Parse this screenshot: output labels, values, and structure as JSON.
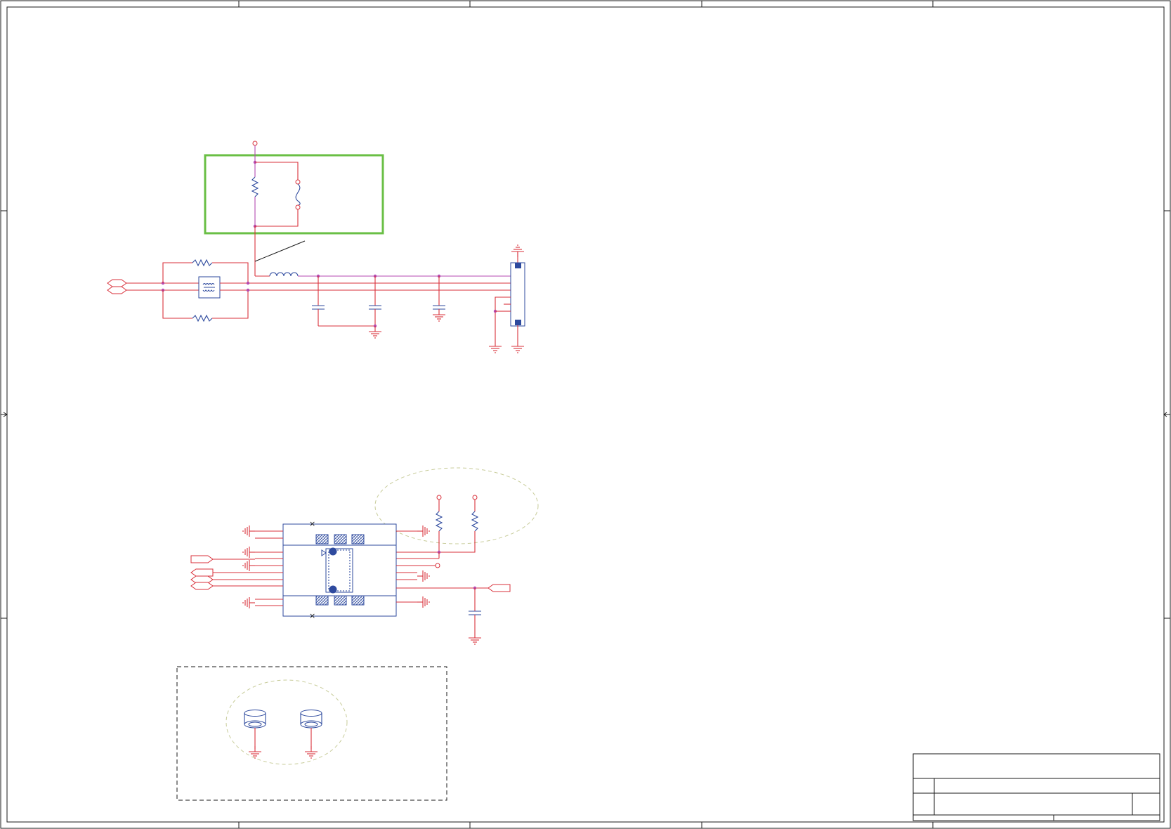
{
  "sheet": {
    "border_color": "#1a1a1a",
    "zone_columns": 5,
    "zone_rows": 4
  },
  "colors": {
    "wire": "#d9313b",
    "component": "#2e4a9e",
    "junction": "#b44ab1",
    "highlight_box": "#6abf45",
    "dashed_region": "#1a1a1a",
    "ellipse_outline": "#c8cc9a"
  },
  "title_block": {
    "title": "",
    "size": "",
    "document_number": "",
    "revision": "",
    "date": "",
    "sheet": ""
  }
}
